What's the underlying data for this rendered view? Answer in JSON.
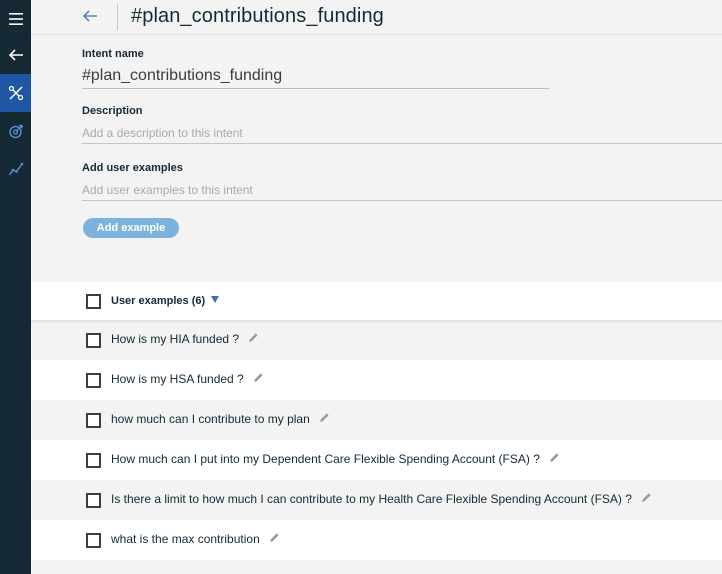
{
  "header": {
    "title": "#plan_contributions_funding"
  },
  "form": {
    "intent_name_label": "Intent name",
    "intent_name_value": "#plan_contributions_funding",
    "description_label": "Description",
    "description_placeholder": "Add a description to this intent",
    "examples_label": "Add user examples",
    "examples_placeholder": "Add user examples to this intent",
    "add_button_label": "Add example"
  },
  "examples": {
    "header_label": "User examples (6)",
    "items": [
      "How is my HIA funded ?",
      "How is my HSA funded ?",
      "how much can I contribute to my plan",
      "How much can I put into my Dependent Care Flexible Spending Account (FSA) ?",
      "Is there a limit to how much I can contribute to my Health Care Flexible Spending Account (FSA) ?",
      "what is the max contribution"
    ]
  },
  "colors": {
    "rail": "#152934",
    "rail_active": "#1f57a4",
    "accent": "#3d70b2",
    "button": "#7cb3dc"
  },
  "icons": {
    "rail": [
      "menu-icon",
      "back-arrow-icon",
      "tools-icon",
      "target-icon",
      "analytics-icon"
    ],
    "row_edit": "pencil-icon"
  }
}
